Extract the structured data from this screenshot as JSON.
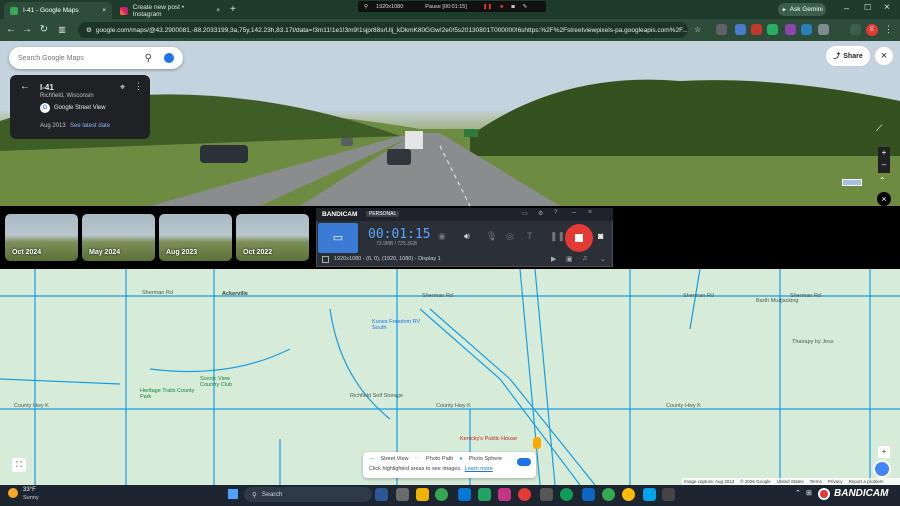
{
  "browser": {
    "tabs": [
      {
        "title": "I-41 - Google Maps"
      },
      {
        "title": "Create new post • Instagram"
      }
    ],
    "url": "google.com/maps/@43.2900081,-88.2033199,3a,75y,142.23h,83.17t/data=!3m11!1e1!3m9!1sjpr88srUlj_kDkmK80GGw!2e0!5s20130801T000000!6shttps:%2F%2Fstreetviewpixels-pa.googleapis.com%2F...",
    "ask_gemini": "Ask Gemini",
    "recording_bar": {
      "resolution": "1920x1080",
      "status": "Pause [00:01:15]"
    }
  },
  "maps": {
    "search_placeholder": "Search Google Maps",
    "card": {
      "title": "I-41",
      "subtitle": "Richfield, Wisconsin",
      "source": "Google Street View",
      "date": "Aug 2013",
      "latest_link": "See latest date"
    },
    "share_label": "Share",
    "timeline": [
      {
        "label": "Oct 2024"
      },
      {
        "label": "May 2024"
      },
      {
        "label": "Aug 2023"
      },
      {
        "label": "Oct 2022"
      }
    ],
    "map_labels": {
      "ackerville": "Ackerville",
      "kunes": "Kunes Freedom RV South",
      "heritage": "Heritage Trails County Park",
      "scenic": "Scenic View Country Club",
      "storage": "Richfield Self Storage",
      "kenickys": "Kenicky's Public House",
      "barth": "Barth Mudjacking",
      "thairapy": "Thairapy by Jess",
      "sherman1": "Sherman Rd",
      "sherman2": "Sherman Rd",
      "sherman3": "Sherman Rd",
      "sherman4": "Sherman Rd",
      "hwy_k": "County Hwy K",
      "hwy_k2": "County Hwy K",
      "hwy_k3": "County Hwy K"
    },
    "legend": {
      "street_view": "Street View",
      "photo_path": "Photo Path",
      "photo_sphere": "Photo Sphere",
      "hint": "Click highlighted areas to see images.",
      "learn_more": "Learn more"
    },
    "footer": {
      "imagery": "Image capture: Aug 2013",
      "copyright": "© 2026 Google",
      "us": "United States",
      "terms": "Terms",
      "privacy": "Privacy",
      "report": "Report a problem"
    }
  },
  "bandicam": {
    "brand": "BANDICAM",
    "edition": "PERSONAL",
    "timer": "00:01:15",
    "size": "73.9MB / 725.3GB",
    "region": "1920x1080 - (0, 0), (1920, 1080) - Display 1"
  },
  "taskbar": {
    "weather_temp": "33°F",
    "weather_desc": "Sunny",
    "search": "Search",
    "watermark": "BANDICAM"
  },
  "colors": {
    "accent_blue": "#1a73e8",
    "record_red": "#e53935",
    "street_view_line": "#1a9de0"
  }
}
